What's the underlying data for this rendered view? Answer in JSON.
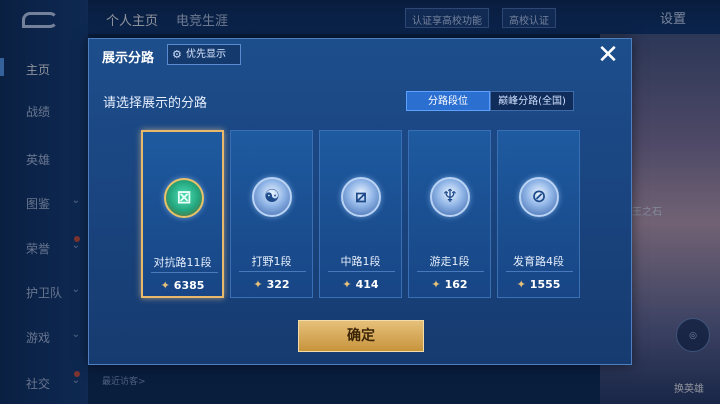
{
  "sidebar": {
    "items": [
      {
        "label": "主页",
        "chevron": false,
        "dot": false,
        "active": true
      },
      {
        "label": "战绩",
        "chevron": false,
        "dot": false
      },
      {
        "label": "英雄",
        "chevron": false,
        "dot": false
      },
      {
        "label": "图鉴",
        "chevron": true,
        "dot": false
      },
      {
        "label": "荣誉",
        "chevron": true,
        "dot": true
      },
      {
        "label": "护卫队",
        "chevron": true,
        "dot": false
      },
      {
        "label": "游戏",
        "chevron": true,
        "dot": false
      },
      {
        "label": "社交",
        "chevron": true,
        "dot": true
      }
    ]
  },
  "topbar": {
    "tabs": [
      "个人主页",
      "电竞生涯"
    ],
    "campus_auth_text": "认证享高校功能",
    "campus_auth_badge": "高校认证",
    "settings": "设置"
  },
  "background": {
    "recent_visitors": "最近访客>",
    "rank_fragment": "王之石",
    "right_button_label": "换英雄"
  },
  "modal": {
    "title": "展示分路",
    "priority_button": "优先显示",
    "subtitle": "请选择展示的分路",
    "toggle": {
      "on": "分路段位",
      "off": "巅峰分路(全国)"
    },
    "confirm": "确定",
    "lanes": [
      {
        "name": "对抗路11段",
        "score": "6385",
        "icon": "clash-lane-icon",
        "glyph": "⊠",
        "selected": true
      },
      {
        "name": "打野1段",
        "score": "322",
        "icon": "jungle-icon",
        "glyph": "☯",
        "selected": false
      },
      {
        "name": "中路1段",
        "score": "414",
        "icon": "mid-lane-icon",
        "glyph": "⧄",
        "selected": false
      },
      {
        "name": "游走1段",
        "score": "162",
        "icon": "roam-icon",
        "glyph": "♆",
        "selected": false
      },
      {
        "name": "发育路4段",
        "score": "1555",
        "icon": "farm-lane-icon",
        "glyph": "⊘",
        "selected": false
      }
    ]
  },
  "colors": {
    "accent": "#2b6fd1",
    "gold": "#e6c07a",
    "modal_bg": "#1a4580"
  }
}
